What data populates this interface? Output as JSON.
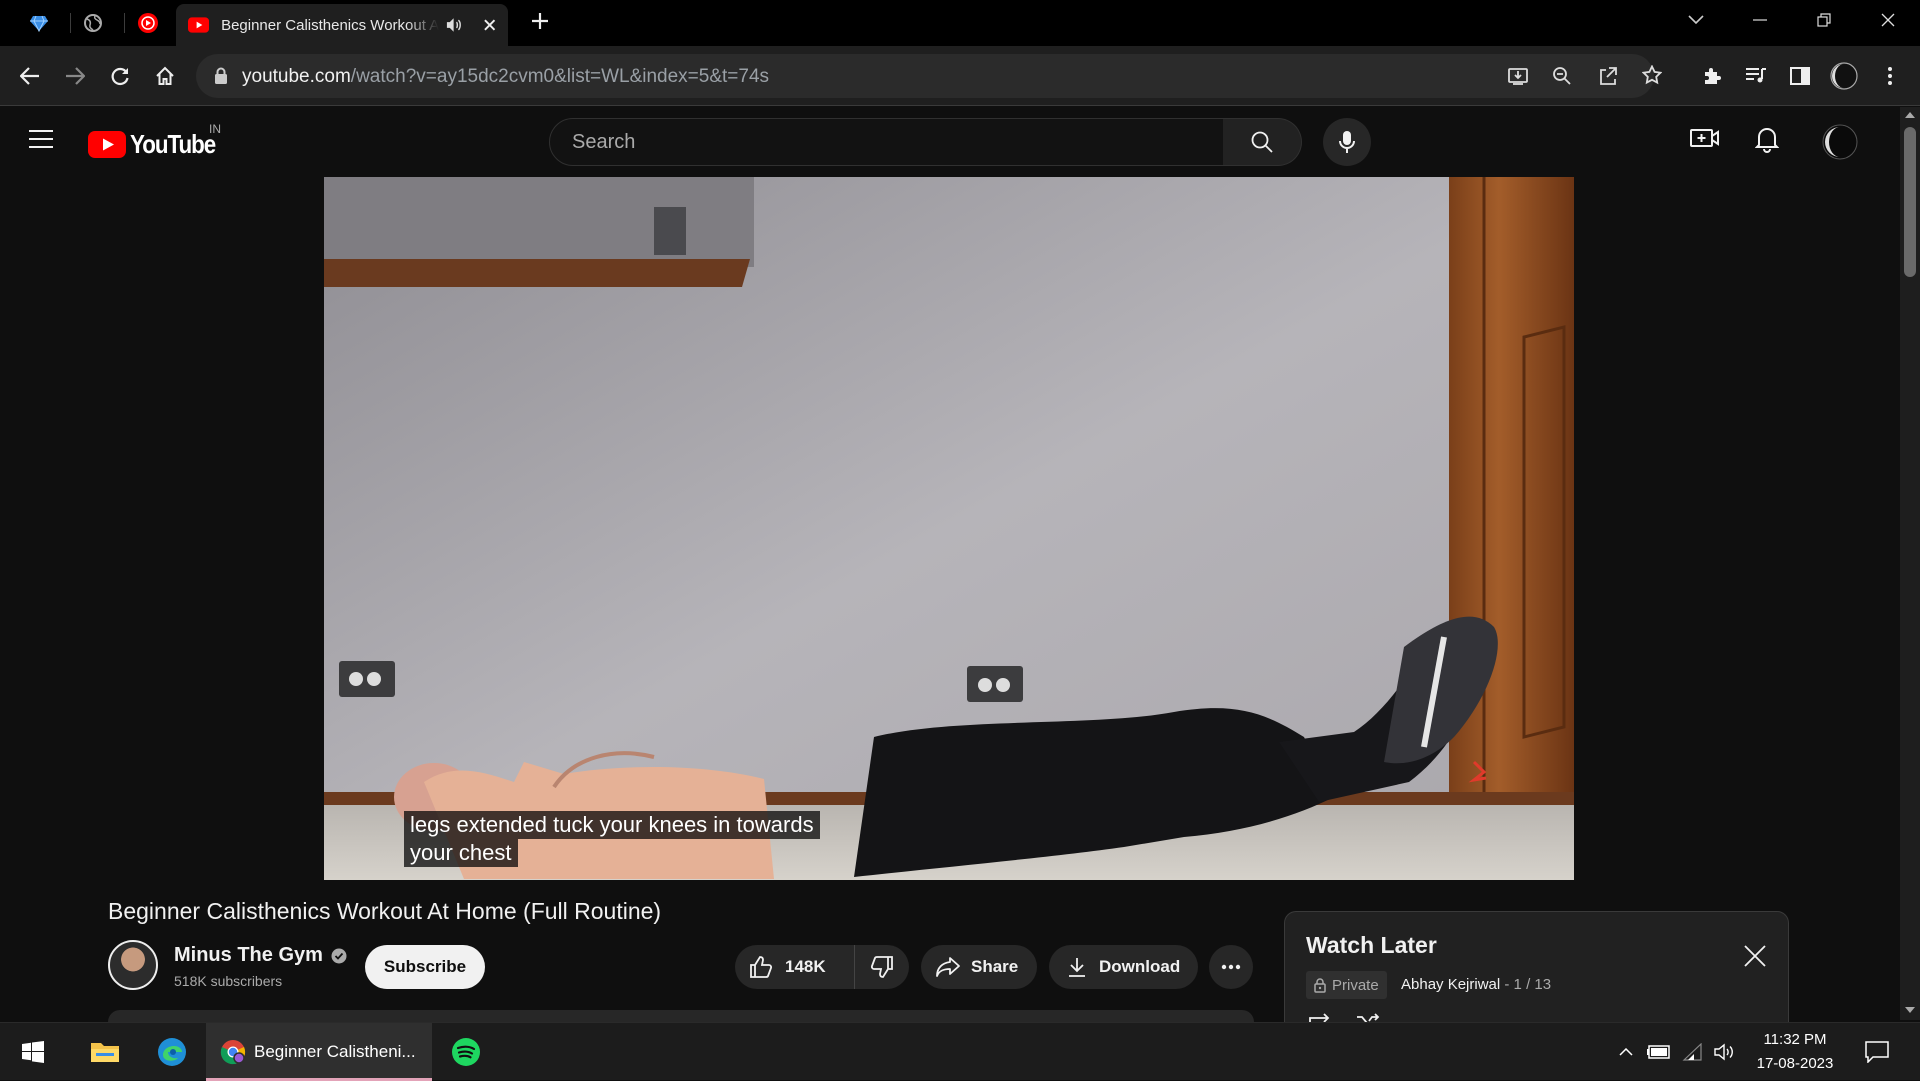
{
  "browser": {
    "active_tab_title": "Beginner Calisthenics Workout At Home (Full Routine) - YouTube",
    "url_host": "youtube.com",
    "url_path": "/watch?v=ay15dc2cvm0&list=WL&index=5&t=74s"
  },
  "youtube": {
    "logo_text": "YouTube",
    "country_code": "IN",
    "search_placeholder": "Search"
  },
  "video": {
    "caption_line1": "legs extended tuck your knees in towards",
    "caption_line2": "your chest",
    "title": "Beginner Calisthenics Workout At Home (Full Routine)",
    "channel_name": "Minus The Gym",
    "subscribers": "518K subscribers",
    "subscribe_label": "Subscribe",
    "likes": "148K",
    "share_label": "Share",
    "download_label": "Download"
  },
  "playlist": {
    "title": "Watch Later",
    "privacy": "Private",
    "owner": "Abhay Kejriwal",
    "position": "- 1 / 13"
  },
  "taskbar": {
    "chrome_window_title": "Beginner Calistheni...",
    "time": "11:32 PM",
    "date": "17-08-2023"
  },
  "colors": {
    "youtube_red": "#ff0000",
    "background": "#0f0f0f",
    "spotify_green": "#1ed760"
  }
}
